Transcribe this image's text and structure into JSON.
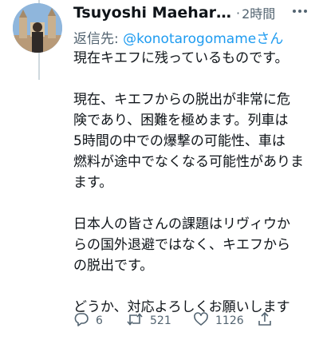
{
  "tweet": {
    "author_name": "Tsuyoshi Maehara /…",
    "separator": "·",
    "time": "2時間",
    "reply_prefix": "返信先: ",
    "reply_to": "@konotarogomameさん",
    "paragraphs": [
      [
        "現在キエフに残っているものです。"
      ],
      [
        "現在、キエフからの脱出が非常に危",
        "険であり、困難を極めます。列車は",
        "5時間の中での爆撃の可能性、車は",
        "燃料が途中でなくなる可能性がありま",
        "ます。"
      ],
      [
        "日本人の皆さんの課題はリヴィウか",
        "らの国外退避ではなく、キエフから",
        "の脱出です。"
      ],
      [
        "どうか、対応よろしくお願いします"
      ]
    ],
    "actions": {
      "reply_icon": "reply-icon",
      "reply_count": "6",
      "retweet_icon": "retweet-icon",
      "retweet_count": "521",
      "like_icon": "heart-icon",
      "like_count": "1126",
      "share_icon": "share-icon"
    }
  },
  "colors": {
    "text": "#0f1419",
    "secondary": "#536471",
    "link": "#1d9bf0",
    "thread_line": "#cfd9de"
  }
}
